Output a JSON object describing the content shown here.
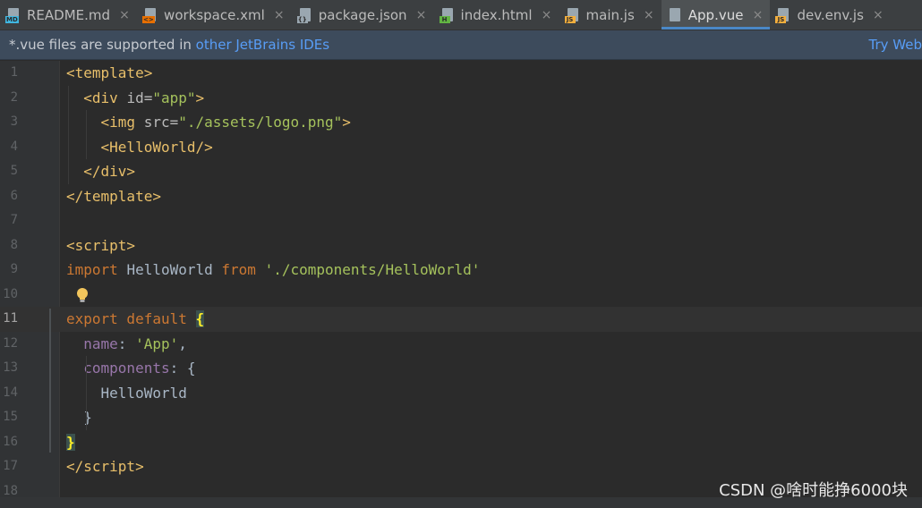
{
  "tabs": [
    {
      "label": "README.md",
      "badge": "MD",
      "badge_color": "#40b6e0",
      "active": false
    },
    {
      "label": "workspace.xml",
      "badge": "<>",
      "badge_color": "#e76f00",
      "active": false
    },
    {
      "label": "package.json",
      "badge": "{}",
      "badge_color": "#9aa7b0",
      "active": false
    },
    {
      "label": "index.html",
      "badge": "H",
      "badge_color": "#62b543",
      "active": false
    },
    {
      "label": "main.js",
      "badge": "JS",
      "badge_color": "#f4af3d",
      "active": false
    },
    {
      "label": "App.vue",
      "badge": "",
      "badge_color": "#9aa7b0",
      "active": true
    },
    {
      "label": "dev.env.js",
      "badge": "JS",
      "badge_color": "#f4af3d",
      "active": false
    }
  ],
  "tab_close_glyph": "×",
  "banner": {
    "text": "*.vue files are supported in ",
    "link": "other JetBrains IDEs",
    "right_link": "Try Web"
  },
  "lines": [
    {
      "n": "1",
      "html": "<span class=\"tag\">&lt;template&gt;</span>"
    },
    {
      "n": "2",
      "html": "  <span class=\"tag\">&lt;div </span><span class=\"attr\">id=</span><span class=\"str\">\"app\"</span><span class=\"tag\">&gt;</span>"
    },
    {
      "n": "3",
      "html": "    <span class=\"tag\">&lt;img </span><span class=\"attr\">src=</span><span class=\"str\">\"./assets/logo.png\"</span><span class=\"tag\">&gt;</span>"
    },
    {
      "n": "4",
      "html": "    <span class=\"tag\">&lt;HelloWorld/&gt;</span>"
    },
    {
      "n": "5",
      "html": "  <span class=\"tag\">&lt;/div&gt;</span>"
    },
    {
      "n": "6",
      "html": "<span class=\"tag\">&lt;/template&gt;</span>"
    },
    {
      "n": "7",
      "html": ""
    },
    {
      "n": "8",
      "html": "<span class=\"tag\">&lt;script&gt;</span>"
    },
    {
      "n": "9",
      "html": "<span class=\"kw\">import </span>HelloWorld <span class=\"kw\">from </span><span class=\"str\">'./components/HelloWorld'</span>"
    },
    {
      "n": "10",
      "html": ""
    },
    {
      "n": "11",
      "html": "<span class=\"kw\">export default </span><span class=\"brace-hl\">{</span>"
    },
    {
      "n": "12",
      "html": "  <span class=\"prop\">name</span>: <span class=\"str\">'App'</span>,"
    },
    {
      "n": "13",
      "html": "  <span class=\"prop\">components</span>: {"
    },
    {
      "n": "14",
      "html": "    HelloWorld"
    },
    {
      "n": "15",
      "html": "  }"
    },
    {
      "n": "16",
      "html": "<span class=\"brace-hl\">}</span>"
    },
    {
      "n": "17",
      "html": "<span class=\"tag\">&lt;/script&gt;</span>"
    },
    {
      "n": "18",
      "html": ""
    }
  ],
  "current_line": "11",
  "watermark": "CSDN @啥时能挣6000块"
}
